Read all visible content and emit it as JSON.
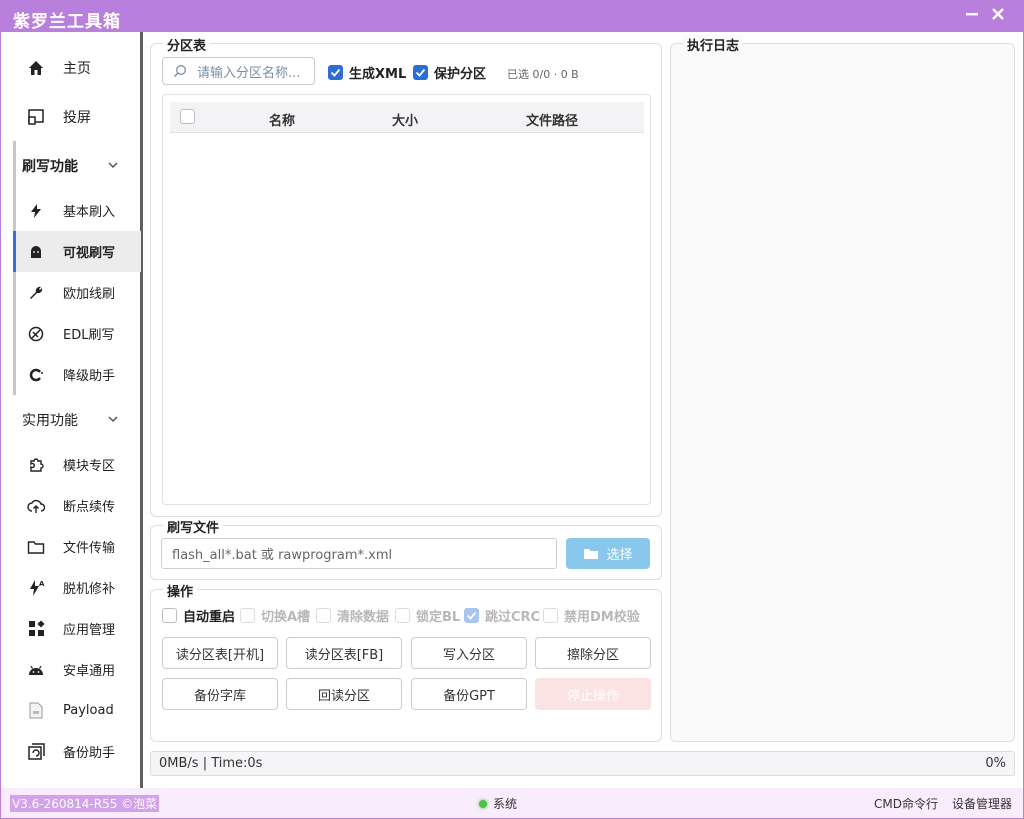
{
  "window": {
    "title": "紫罗兰工具箱"
  },
  "sidebar": {
    "home": "主页",
    "cast": "投屏",
    "flash_group": "刷写功能",
    "flash_items": [
      "基本刷入",
      "可视刷写",
      "欧加线刷",
      "EDL刷写",
      "降级助手"
    ],
    "util_group": "实用功能",
    "util_items": [
      "模块专区",
      "断点续传",
      "文件传输",
      "脱机修补",
      "应用管理",
      "安卓通用",
      "Payload",
      "备份助手"
    ]
  },
  "partition": {
    "title": "分区表",
    "search_placeholder": "请输入分区名称...",
    "gen_xml": "生成XML",
    "protect": "保护分区",
    "selected": "已选 0/0 · 0 B",
    "columns": [
      "名称",
      "大小",
      "文件路径"
    ]
  },
  "flash_file": {
    "title": "刷写文件",
    "placeholder": "flash_all*.bat 或 rawprogram*.xml",
    "select": "选择"
  },
  "operations": {
    "title": "操作",
    "options": [
      "自动重启",
      "切换A槽",
      "清除数据",
      "锁定BL",
      "跳过CRC",
      "禁用DM校验"
    ],
    "buttons_row1": [
      "读分区表[开机]",
      "读分区表[FB]",
      "写入分区",
      "擦除分区"
    ],
    "buttons_row2": [
      "备份字库",
      "回读分区",
      "备份GPT",
      "停止操作"
    ]
  },
  "log": {
    "title": "执行日志"
  },
  "status": {
    "left": "0MB/s  |  Time:0s",
    "right": "0%"
  },
  "footer": {
    "version": "V3.6-260814-R55 ©泡菜",
    "system": "系统",
    "cmd": "CMD命令行",
    "device_mgr": "设备管理器"
  },
  "colors": {
    "title_bar": "#b97fdc",
    "accent": "#2d6dd8",
    "select_button": "#89c8ec",
    "active_indicator": "#3b6fd8"
  }
}
